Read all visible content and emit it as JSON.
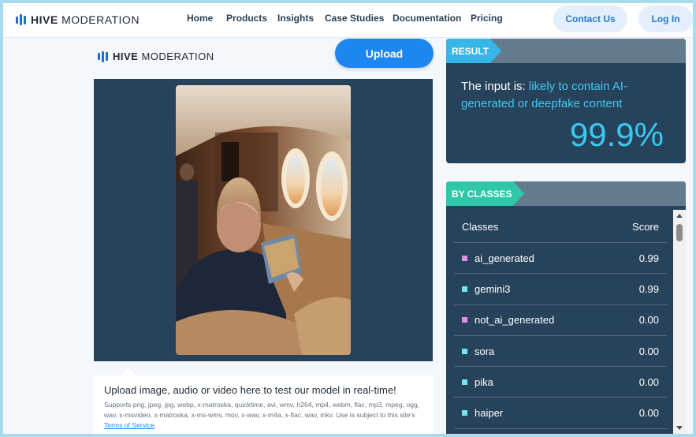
{
  "brand": {
    "name_bold": "HIVE",
    "name_light": "MODERATION",
    "color": "#1f6fd1"
  },
  "nav": {
    "links": [
      "Home",
      "Products",
      "Insights",
      "Case Studies",
      "Documentation",
      "Pricing"
    ],
    "contact": "Contact Us",
    "login": "Log In"
  },
  "upload": {
    "button": "Upload",
    "title": "Upload image, audio or video here to test our model in real-time!",
    "description": "Supports png, jpeg, jpg, webp, x-matroska, quicktime, avi, wmv, h264, mp4, webm, flac, mp3, mpeg, ogg, wav, x-msvideo, x-matroska, x-ms-wmv, mov, x-wav, x-m4a, x-flac, wav, mkv. Use is subject to this site's",
    "terms_link": "Terms of Service",
    "terms_end": "."
  },
  "result": {
    "tag": "RESULT",
    "tag_color": "#38b6e8",
    "prefix": "The input is:",
    "verdict": "likely to contain AI-generated or deepfake content",
    "value": "99.9%"
  },
  "classes": {
    "tag": "BY CLASSES",
    "tag_color": "#2fc7a7",
    "header_class": "Classes",
    "header_score": "Score",
    "rows": [
      {
        "name": "ai_generated",
        "score": "0.99",
        "color": "#e58ae8"
      },
      {
        "name": "gemini3",
        "score": "0.99",
        "color": "#72e6f2"
      },
      {
        "name": "not_ai_generated",
        "score": "0.00",
        "color": "#e58ae8"
      },
      {
        "name": "sora",
        "score": "0.00",
        "color": "#72e6f2"
      },
      {
        "name": "pika",
        "score": "0.00",
        "color": "#72e6f2"
      },
      {
        "name": "haiper",
        "score": "0.00",
        "color": "#72e6f2"
      }
    ]
  }
}
